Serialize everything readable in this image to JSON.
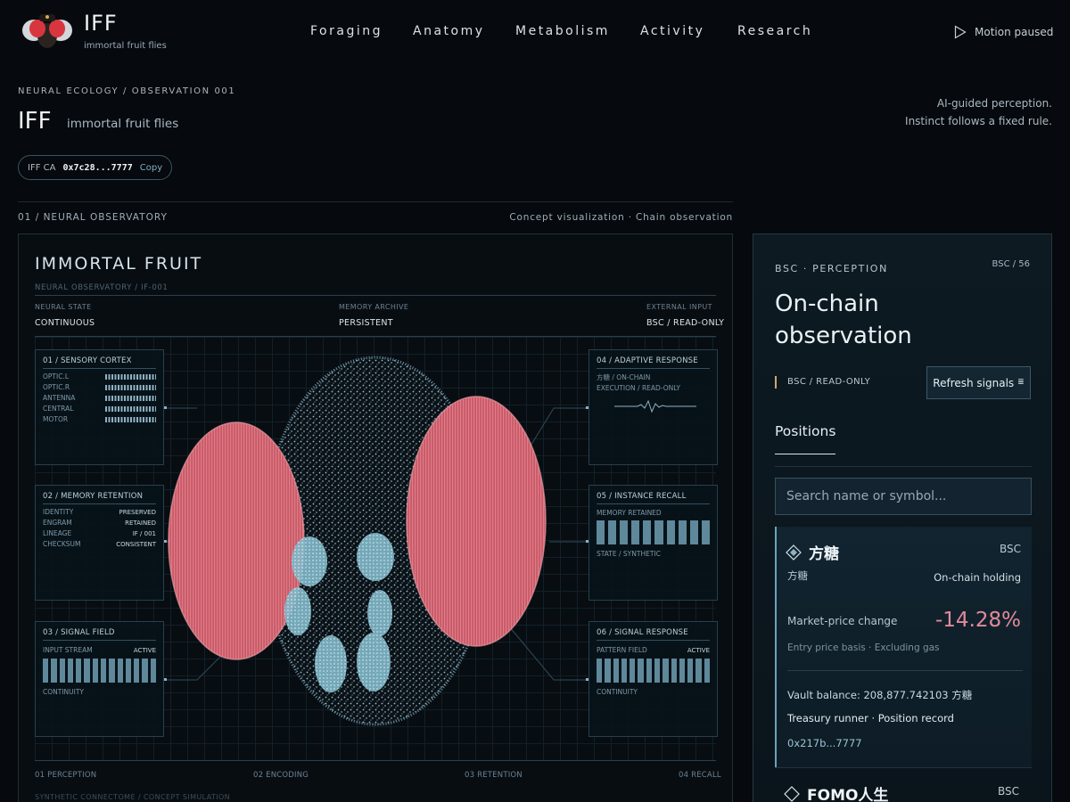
{
  "brand": {
    "title": "IFF",
    "subtitle": "immortal fruit flies"
  },
  "nav": [
    "Foraging",
    "Anatomy",
    "Metabolism",
    "Activity",
    "Research"
  ],
  "motion_label": "Motion paused",
  "header": {
    "breadcrumb": "NEURAL ECOLOGY / OBSERVATION 001",
    "title": "IFF",
    "subtitle": "immortal fruit flies",
    "tagline_1": "AI-guided perception.",
    "tagline_2": "Instinct follows a fixed rule.",
    "ca_label": "IFF CA",
    "ca_address": "0x7c28...7777",
    "ca_copy": "Copy"
  },
  "section": {
    "left": "01 / NEURAL OBSERVATORY",
    "right": "Concept visualization · Chain observation"
  },
  "observatory": {
    "title": "IMMORTAL FRUIT",
    "sub": "NEURAL OBSERVATORY / IF-001",
    "status": [
      {
        "label": "NEURAL STATE",
        "value": "CONTINUOUS"
      },
      {
        "label": "MEMORY ARCHIVE",
        "value": "PERSISTENT"
      },
      {
        "label": "EXTERNAL INPUT",
        "value": "BSC / READ-ONLY"
      }
    ],
    "cards": {
      "c1": {
        "title": "01 / SENSORY CORTEX",
        "rows": [
          "OPTIC.L",
          "OPTIC.R",
          "ANTENNA",
          "CENTRAL",
          "MOTOR"
        ]
      },
      "c2": {
        "title": "02 / MEMORY RETENTION",
        "rows": [
          {
            "k": "IDENTITY",
            "v": "PRESERVED"
          },
          {
            "k": "ENGRAM",
            "v": "RETAINED"
          },
          {
            "k": "LINEAGE",
            "v": "IF / 001"
          },
          {
            "k": "CHECKSUM",
            "v": "CONSISTENT"
          }
        ]
      },
      "c3": {
        "title": "03 / SIGNAL FIELD",
        "k": "INPUT STREAM",
        "v": "ACTIVE",
        "foot": "CONTINUITY"
      },
      "c4": {
        "title": "04 / ADAPTIVE RESPONSE",
        "line1": "方糖 / ON-CHAIN",
        "line2": "EXECUTION / READ-ONLY"
      },
      "c5": {
        "title": "05 / INSTANCE RECALL",
        "k": "MEMORY RETAINED",
        "foot": "STATE / SYNTHETIC"
      },
      "c6": {
        "title": "06 / SIGNAL RESPONSE",
        "k": "PATTERN FIELD",
        "v": "ACTIVE",
        "foot": "CONTINUITY"
      }
    },
    "stages": [
      "01 PERCEPTION",
      "02 ENCODING",
      "03 RETENTION",
      "04 RECALL"
    ],
    "footer": "SYNTHETIC CONNECTOME / CONCEPT SIMULATION"
  },
  "panel": {
    "kicker": "BSC · PERCEPTION",
    "count": "BSC / 56",
    "title": "On-chain observation",
    "mode": "BSC / READ-ONLY",
    "refresh": "Refresh signals",
    "tab": "Positions",
    "search_placeholder": "Search name or symbol...",
    "positions": [
      {
        "name": "方糖",
        "chain": "BSC",
        "sub": "方糖",
        "status": "On-chain holding",
        "metric_label": "Market-price change",
        "metric_value": "-14.28%",
        "basis": "Entry price basis · Excluding gas",
        "vault": "Vault balance: 208,877.742103 方糖",
        "runner": "Treasury runner · Position record",
        "address": "0x217b...7777"
      },
      {
        "name": "FOMO人生",
        "chain": "BSC"
      }
    ]
  },
  "colors": {
    "accent": "#6fa2b8",
    "negative": "#e38a9b",
    "eye": "#d9646f",
    "mode_marker": "#d4a574"
  }
}
